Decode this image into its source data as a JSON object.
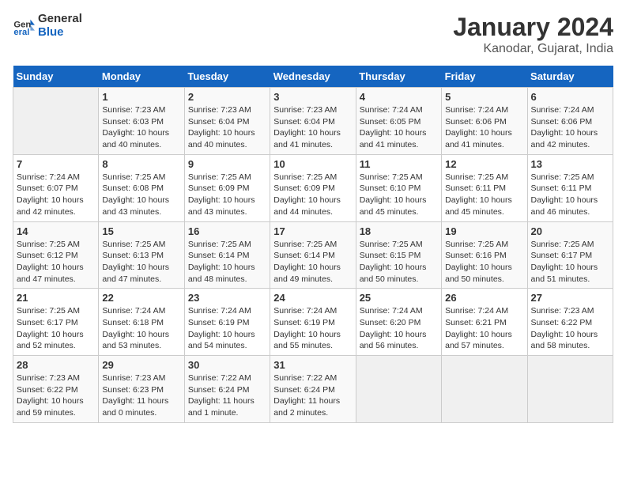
{
  "header": {
    "logo_text_general": "General",
    "logo_text_blue": "Blue",
    "title": "January 2024",
    "subtitle": "Kanodar, Gujarat, India"
  },
  "calendar": {
    "days_of_week": [
      "Sunday",
      "Monday",
      "Tuesday",
      "Wednesday",
      "Thursday",
      "Friday",
      "Saturday"
    ],
    "weeks": [
      [
        {
          "day": "",
          "info": ""
        },
        {
          "day": "1",
          "info": "Sunrise: 7:23 AM\nSunset: 6:03 PM\nDaylight: 10 hours\nand 40 minutes."
        },
        {
          "day": "2",
          "info": "Sunrise: 7:23 AM\nSunset: 6:04 PM\nDaylight: 10 hours\nand 40 minutes."
        },
        {
          "day": "3",
          "info": "Sunrise: 7:23 AM\nSunset: 6:04 PM\nDaylight: 10 hours\nand 41 minutes."
        },
        {
          "day": "4",
          "info": "Sunrise: 7:24 AM\nSunset: 6:05 PM\nDaylight: 10 hours\nand 41 minutes."
        },
        {
          "day": "5",
          "info": "Sunrise: 7:24 AM\nSunset: 6:06 PM\nDaylight: 10 hours\nand 41 minutes."
        },
        {
          "day": "6",
          "info": "Sunrise: 7:24 AM\nSunset: 6:06 PM\nDaylight: 10 hours\nand 42 minutes."
        }
      ],
      [
        {
          "day": "7",
          "info": "Sunrise: 7:24 AM\nSunset: 6:07 PM\nDaylight: 10 hours\nand 42 minutes."
        },
        {
          "day": "8",
          "info": "Sunrise: 7:25 AM\nSunset: 6:08 PM\nDaylight: 10 hours\nand 43 minutes."
        },
        {
          "day": "9",
          "info": "Sunrise: 7:25 AM\nSunset: 6:09 PM\nDaylight: 10 hours\nand 43 minutes."
        },
        {
          "day": "10",
          "info": "Sunrise: 7:25 AM\nSunset: 6:09 PM\nDaylight: 10 hours\nand 44 minutes."
        },
        {
          "day": "11",
          "info": "Sunrise: 7:25 AM\nSunset: 6:10 PM\nDaylight: 10 hours\nand 45 minutes."
        },
        {
          "day": "12",
          "info": "Sunrise: 7:25 AM\nSunset: 6:11 PM\nDaylight: 10 hours\nand 45 minutes."
        },
        {
          "day": "13",
          "info": "Sunrise: 7:25 AM\nSunset: 6:11 PM\nDaylight: 10 hours\nand 46 minutes."
        }
      ],
      [
        {
          "day": "14",
          "info": "Sunrise: 7:25 AM\nSunset: 6:12 PM\nDaylight: 10 hours\nand 47 minutes."
        },
        {
          "day": "15",
          "info": "Sunrise: 7:25 AM\nSunset: 6:13 PM\nDaylight: 10 hours\nand 47 minutes."
        },
        {
          "day": "16",
          "info": "Sunrise: 7:25 AM\nSunset: 6:14 PM\nDaylight: 10 hours\nand 48 minutes."
        },
        {
          "day": "17",
          "info": "Sunrise: 7:25 AM\nSunset: 6:14 PM\nDaylight: 10 hours\nand 49 minutes."
        },
        {
          "day": "18",
          "info": "Sunrise: 7:25 AM\nSunset: 6:15 PM\nDaylight: 10 hours\nand 50 minutes."
        },
        {
          "day": "19",
          "info": "Sunrise: 7:25 AM\nSunset: 6:16 PM\nDaylight: 10 hours\nand 50 minutes."
        },
        {
          "day": "20",
          "info": "Sunrise: 7:25 AM\nSunset: 6:17 PM\nDaylight: 10 hours\nand 51 minutes."
        }
      ],
      [
        {
          "day": "21",
          "info": "Sunrise: 7:25 AM\nSunset: 6:17 PM\nDaylight: 10 hours\nand 52 minutes."
        },
        {
          "day": "22",
          "info": "Sunrise: 7:24 AM\nSunset: 6:18 PM\nDaylight: 10 hours\nand 53 minutes."
        },
        {
          "day": "23",
          "info": "Sunrise: 7:24 AM\nSunset: 6:19 PM\nDaylight: 10 hours\nand 54 minutes."
        },
        {
          "day": "24",
          "info": "Sunrise: 7:24 AM\nSunset: 6:19 PM\nDaylight: 10 hours\nand 55 minutes."
        },
        {
          "day": "25",
          "info": "Sunrise: 7:24 AM\nSunset: 6:20 PM\nDaylight: 10 hours\nand 56 minutes."
        },
        {
          "day": "26",
          "info": "Sunrise: 7:24 AM\nSunset: 6:21 PM\nDaylight: 10 hours\nand 57 minutes."
        },
        {
          "day": "27",
          "info": "Sunrise: 7:23 AM\nSunset: 6:22 PM\nDaylight: 10 hours\nand 58 minutes."
        }
      ],
      [
        {
          "day": "28",
          "info": "Sunrise: 7:23 AM\nSunset: 6:22 PM\nDaylight: 10 hours\nand 59 minutes."
        },
        {
          "day": "29",
          "info": "Sunrise: 7:23 AM\nSunset: 6:23 PM\nDaylight: 11 hours\nand 0 minutes."
        },
        {
          "day": "30",
          "info": "Sunrise: 7:22 AM\nSunset: 6:24 PM\nDaylight: 11 hours\nand 1 minute."
        },
        {
          "day": "31",
          "info": "Sunrise: 7:22 AM\nSunset: 6:24 PM\nDaylight: 11 hours\nand 2 minutes."
        },
        {
          "day": "",
          "info": ""
        },
        {
          "day": "",
          "info": ""
        },
        {
          "day": "",
          "info": ""
        }
      ]
    ]
  }
}
